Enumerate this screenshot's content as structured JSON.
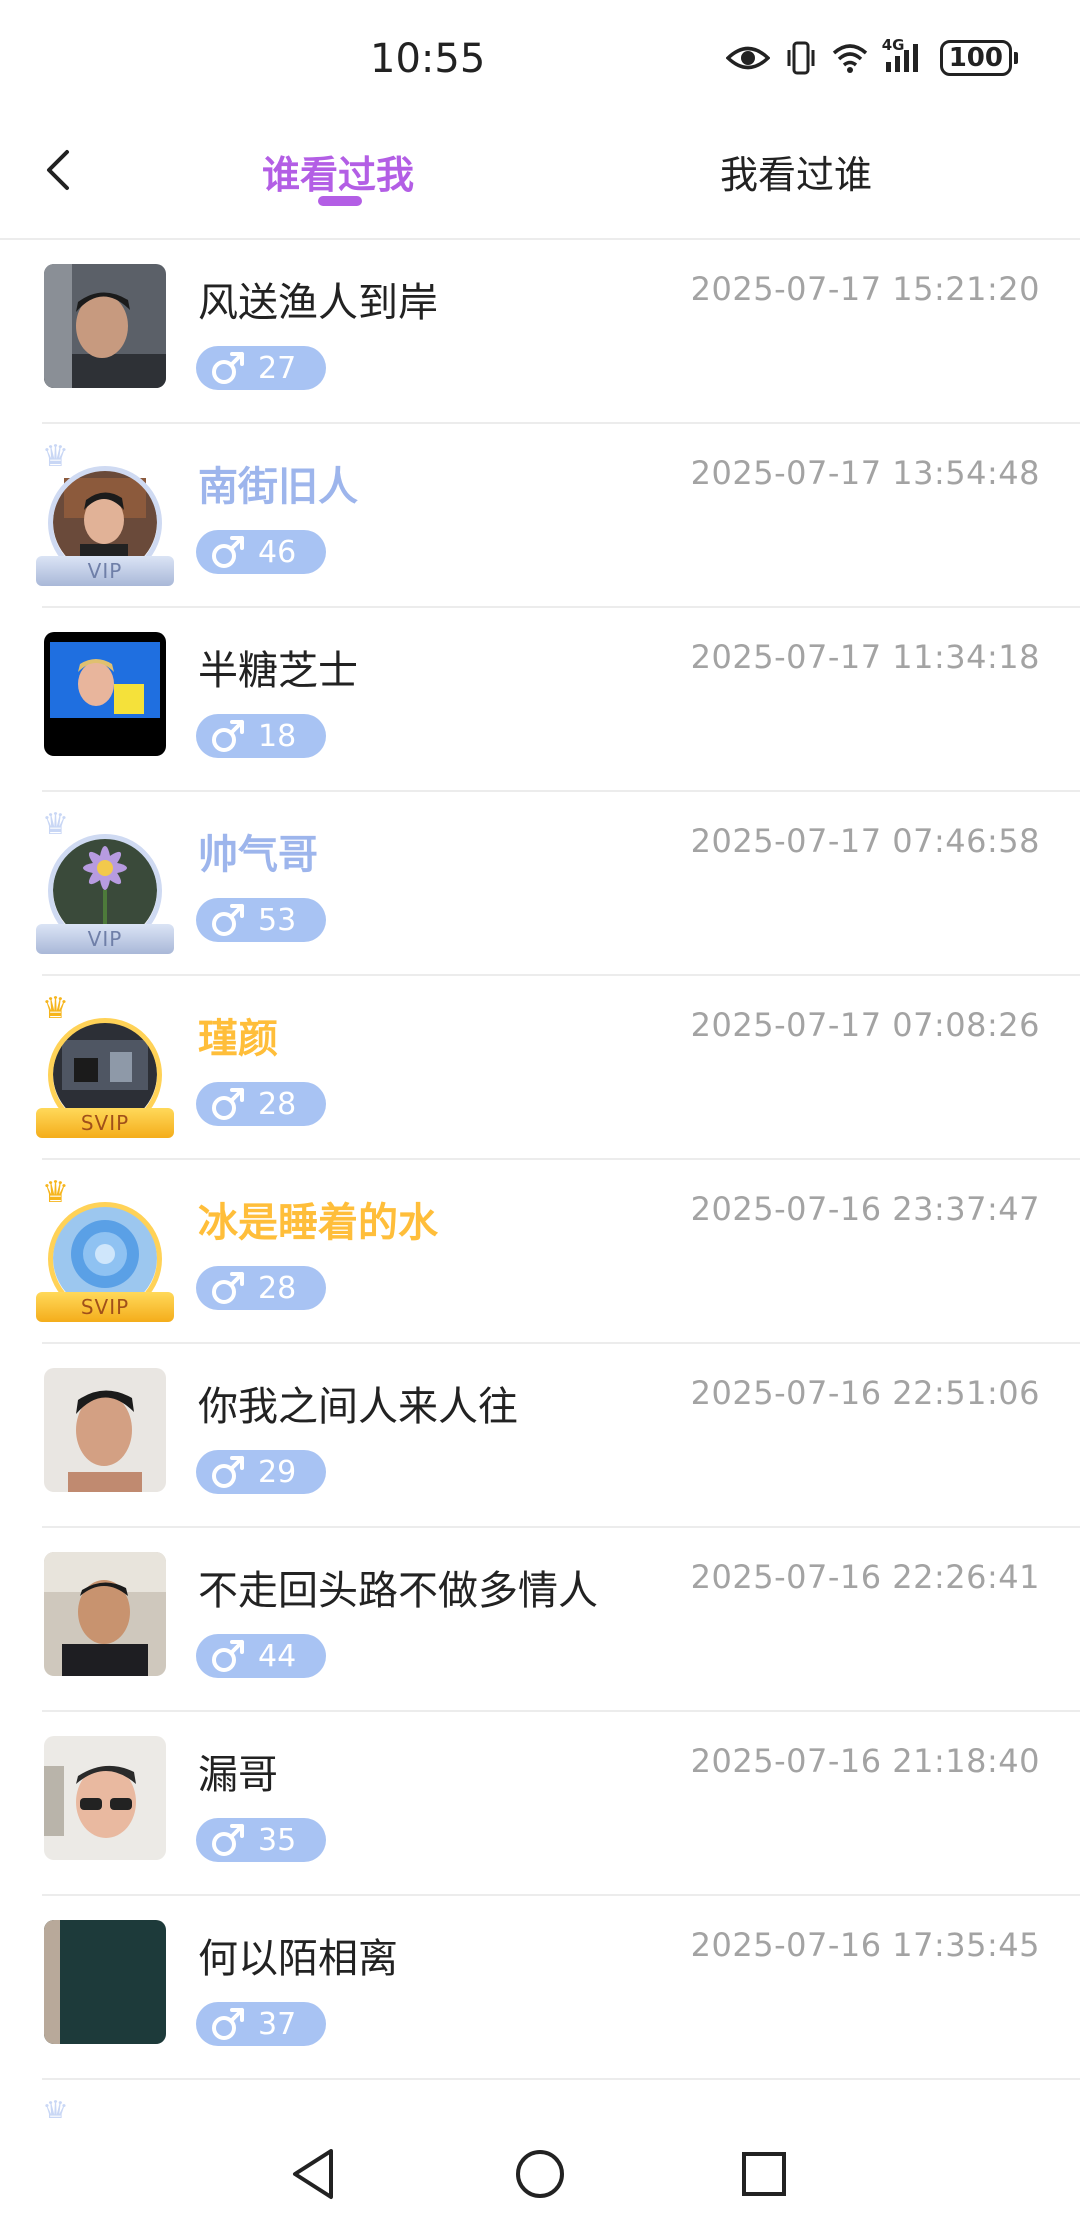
{
  "status_bar": {
    "time": "10:55",
    "network": "4G",
    "battery": "100",
    "icons": [
      "eye-icon",
      "vibrate-icon",
      "wifi-icon",
      "signal-icon",
      "battery-icon"
    ]
  },
  "header": {
    "back_icon": "chevron-left-icon",
    "tabs": [
      {
        "label": "谁看过我",
        "active": true
      },
      {
        "label": "我看过谁",
        "active": false
      }
    ]
  },
  "colors": {
    "accent": "#b35ee5",
    "badge": "#a8c3f3",
    "vip_name": "#9db5ec",
    "svip_name": "#ffbe3a",
    "time_text": "#a3a3a3"
  },
  "visitors": [
    {
      "name": "风送渔人到岸",
      "age": "27",
      "gender_icon": "male-icon",
      "time": "2025-07-17 15:21:20",
      "tier": "none"
    },
    {
      "name": "南街旧人",
      "age": "46",
      "gender_icon": "male-icon",
      "time": "2025-07-17 13:54:48",
      "tier": "vip",
      "badge": "VIP"
    },
    {
      "name": "半糖芝士",
      "age": "18",
      "gender_icon": "male-icon",
      "time": "2025-07-17 11:34:18",
      "tier": "none"
    },
    {
      "name": "帅气哥",
      "age": "53",
      "gender_icon": "male-icon",
      "time": "2025-07-17 07:46:58",
      "tier": "vip",
      "badge": "VIP"
    },
    {
      "name": "瑾颜",
      "age": "28",
      "gender_icon": "male-icon",
      "time": "2025-07-17 07:08:26",
      "tier": "svip",
      "badge": "SVIP"
    },
    {
      "name": "冰是睡着的水",
      "age": "28",
      "gender_icon": "male-icon",
      "time": "2025-07-16 23:37:47",
      "tier": "svip",
      "badge": "SVIP"
    },
    {
      "name": "你我之间人来人往",
      "age": "29",
      "gender_icon": "male-icon",
      "time": "2025-07-16 22:51:06",
      "tier": "none"
    },
    {
      "name": "不走回头路不做多情人",
      "age": "44",
      "gender_icon": "male-icon",
      "time": "2025-07-16 22:26:41",
      "tier": "none"
    },
    {
      "name": "漏哥",
      "age": "35",
      "gender_icon": "male-icon",
      "time": "2025-07-16 21:18:40",
      "tier": "none"
    },
    {
      "name": "何以陌相离",
      "age": "37",
      "gender_icon": "male-icon",
      "time": "2025-07-16 17:35:45",
      "tier": "none"
    }
  ],
  "nav": {
    "icons": [
      "back-triangle-icon",
      "home-circle-icon",
      "recents-square-icon"
    ]
  }
}
